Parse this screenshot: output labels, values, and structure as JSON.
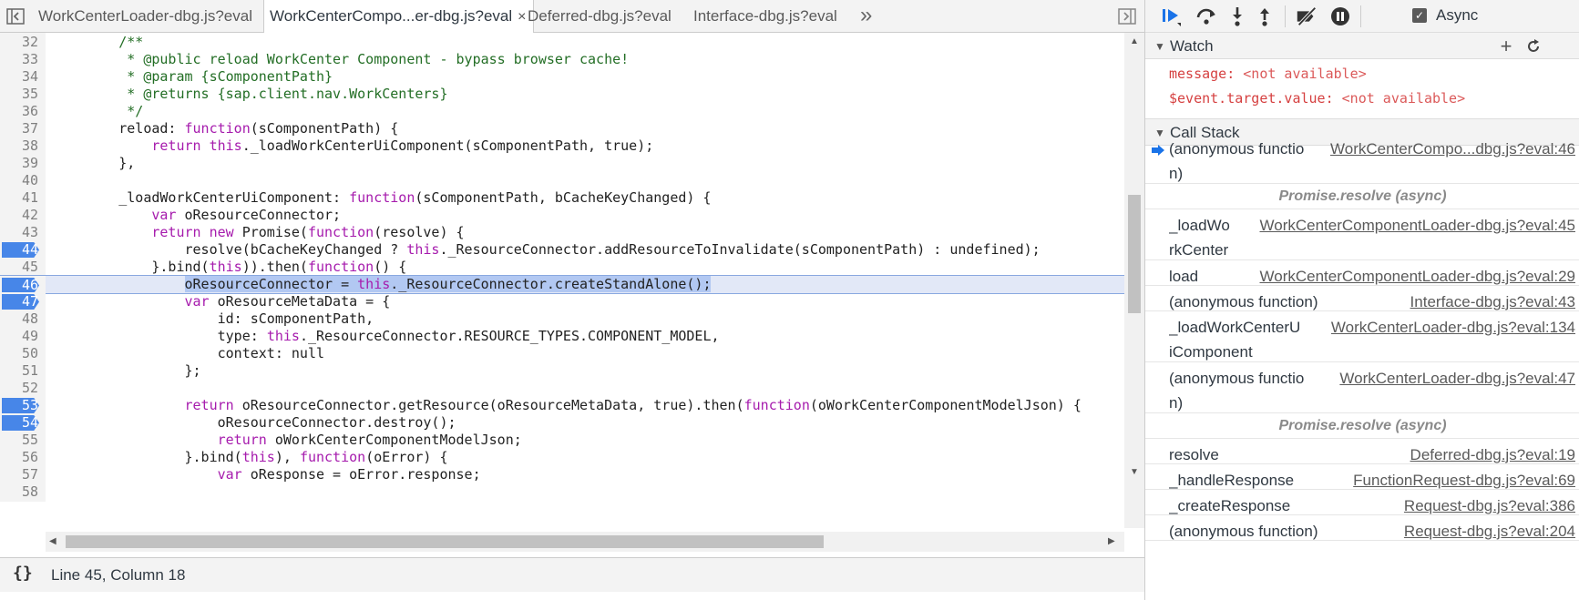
{
  "tabs": [
    {
      "label": "WorkCenterLoader-dbg.js?eval",
      "active": false
    },
    {
      "label": "WorkCenterCompo...er-dbg.js?eval",
      "active": true
    },
    {
      "label": "Deferred-dbg.js?eval",
      "active": false
    },
    {
      "label": "Interface-dbg.js?eval",
      "active": false
    }
  ],
  "tab_close_glyph": "×",
  "tab_more_glyph": "»",
  "code_lines": [
    {
      "num": "32",
      "parts": [
        {
          "t": "        "
        },
        {
          "t": "/**",
          "c": "c"
        }
      ]
    },
    {
      "num": "33",
      "parts": [
        {
          "t": "         "
        },
        {
          "t": "* @public reload WorkCenter Component - bypass browser cache!",
          "c": "c"
        }
      ]
    },
    {
      "num": "34",
      "parts": [
        {
          "t": "         "
        },
        {
          "t": "* @param {sComponentPath}",
          "c": "c"
        }
      ]
    },
    {
      "num": "35",
      "parts": [
        {
          "t": "         "
        },
        {
          "t": "* @returns {sap.client.nav.WorkCenters}",
          "c": "c"
        }
      ]
    },
    {
      "num": "36",
      "parts": [
        {
          "t": "         "
        },
        {
          "t": "*/",
          "c": "c"
        }
      ]
    },
    {
      "num": "37",
      "parts": [
        {
          "t": "        reload: "
        },
        {
          "t": "function",
          "c": "k"
        },
        {
          "t": "(sComponentPath) {"
        }
      ]
    },
    {
      "num": "38",
      "parts": [
        {
          "t": "            "
        },
        {
          "t": "return",
          "c": "k"
        },
        {
          "t": " "
        },
        {
          "t": "this",
          "c": "k"
        },
        {
          "t": "._loadWorkCenterUiComponent(sComponentPath, true);"
        }
      ]
    },
    {
      "num": "39",
      "parts": [
        {
          "t": "        },"
        }
      ]
    },
    {
      "num": "40",
      "parts": [
        {
          "t": ""
        }
      ]
    },
    {
      "num": "41",
      "parts": [
        {
          "t": "        _loadWorkCenterUiComponent: "
        },
        {
          "t": "function",
          "c": "k"
        },
        {
          "t": "(sComponentPath, bCacheKeyChanged) {"
        }
      ]
    },
    {
      "num": "42",
      "parts": [
        {
          "t": "            "
        },
        {
          "t": "var",
          "c": "k"
        },
        {
          "t": " oResourceConnector;"
        }
      ]
    },
    {
      "num": "43",
      "parts": [
        {
          "t": "            "
        },
        {
          "t": "return",
          "c": "k"
        },
        {
          "t": " "
        },
        {
          "t": "new",
          "c": "k"
        },
        {
          "t": " Promise("
        },
        {
          "t": "function",
          "c": "k"
        },
        {
          "t": "(resolve) {"
        }
      ]
    },
    {
      "num": "44",
      "bp": true,
      "parts": [
        {
          "t": "                resolve(bCacheKeyChanged ? "
        },
        {
          "t": "this",
          "c": "k"
        },
        {
          "t": "._ResourceConnector.addResourceToInvalidate(sComponentPath) : undefined);"
        }
      ]
    },
    {
      "num": "45",
      "parts": [
        {
          "t": "            }.bind("
        },
        {
          "t": "this",
          "c": "k"
        },
        {
          "t": ")).then("
        },
        {
          "t": "function",
          "c": "k"
        },
        {
          "t": "() {"
        }
      ]
    },
    {
      "num": "46",
      "bp": true,
      "exec": true,
      "parts": [
        {
          "t": "                "
        },
        {
          "t": "oResourceConnector = ",
          "c": "sel"
        },
        {
          "t": "this",
          "c": "k sel"
        },
        {
          "t": "._ResourceConnector.createStandAlone();",
          "c": "sel"
        }
      ]
    },
    {
      "num": "47",
      "bp": true,
      "parts": [
        {
          "t": "                "
        },
        {
          "t": "var",
          "c": "k"
        },
        {
          "t": " oResourceMetaData = {"
        }
      ]
    },
    {
      "num": "48",
      "parts": [
        {
          "t": "                    id: sComponentPath,"
        }
      ]
    },
    {
      "num": "49",
      "parts": [
        {
          "t": "                    type: "
        },
        {
          "t": "this",
          "c": "k"
        },
        {
          "t": "._ResourceConnector.RESOURCE_TYPES.COMPONENT_MODEL,"
        }
      ]
    },
    {
      "num": "50",
      "parts": [
        {
          "t": "                    context: null"
        }
      ]
    },
    {
      "num": "51",
      "parts": [
        {
          "t": "                };"
        }
      ]
    },
    {
      "num": "52",
      "parts": [
        {
          "t": ""
        }
      ]
    },
    {
      "num": "53",
      "bp": true,
      "parts": [
        {
          "t": "                "
        },
        {
          "t": "return",
          "c": "k"
        },
        {
          "t": " oResourceConnector.getResource(oResourceMetaData, true).then("
        },
        {
          "t": "function",
          "c": "k"
        },
        {
          "t": "(oWorkCenterComponentModelJson) {"
        }
      ]
    },
    {
      "num": "54",
      "bp": true,
      "parts": [
        {
          "t": "                    oResourceConnector.destroy();"
        }
      ]
    },
    {
      "num": "55",
      "parts": [
        {
          "t": "                    "
        },
        {
          "t": "return",
          "c": "k"
        },
        {
          "t": " oWorkCenterComponentModelJson;"
        }
      ]
    },
    {
      "num": "56",
      "parts": [
        {
          "t": "                }.bind("
        },
        {
          "t": "this",
          "c": "k"
        },
        {
          "t": "), "
        },
        {
          "t": "function",
          "c": "k"
        },
        {
          "t": "(oError) {"
        }
      ]
    },
    {
      "num": "57",
      "parts": [
        {
          "t": "                    "
        },
        {
          "t": "var",
          "c": "k"
        },
        {
          "t": " oResponse = oError.response;"
        }
      ]
    },
    {
      "num": "58",
      "parts": [
        {
          "t": ""
        }
      ]
    }
  ],
  "status": {
    "pretty_print_glyph": "{}",
    "cursor_position": "Line 45, Column 18"
  },
  "debugger": {
    "async_label": "Async",
    "async_checked": true,
    "watch": {
      "title": "Watch",
      "expressions": [
        {
          "name": "message",
          "value": "<not available>"
        },
        {
          "name": "$event.target.value",
          "value": "<not available>"
        }
      ]
    },
    "call_stack": {
      "title": "Call Stack",
      "frames": [
        {
          "kind": "frame",
          "current": true,
          "fn": "(anonymous function)",
          "loc": "WorkCenterCompo...dbg.js?eval:46",
          "fnw": 150,
          "h": 56
        },
        {
          "kind": "async",
          "label": "Promise.resolve (async)"
        },
        {
          "kind": "frame",
          "fn": "_loadWorkCenterUiComponent",
          "loc": "WorkCenterComponentLoader-dbg.js?eval:45",
          "fnw": 70,
          "h": 56
        },
        {
          "kind": "frame",
          "fn": "load",
          "loc": "WorkCenterComponentLoader-dbg.js?eval:29",
          "fnw": 70,
          "h": 28
        },
        {
          "kind": "frame",
          "fn": "(anonymous function)",
          "loc": "Interface-dbg.js?eval:43",
          "fnw": 220,
          "h": 28
        },
        {
          "kind": "frame",
          "fn": "_loadWorkCenterUiComponent",
          "loc": "WorkCenterLoader-dbg.js?eval:134",
          "fnw": 148,
          "h": 56
        },
        {
          "kind": "frame",
          "fn": "(anonymous function)",
          "loc": "WorkCenterLoader-dbg.js?eval:47",
          "fnw": 150,
          "h": 56
        },
        {
          "kind": "async",
          "label": "Promise.resolve (async)"
        },
        {
          "kind": "frame",
          "fn": "resolve",
          "loc": "Deferred-dbg.js?eval:19",
          "fnw": 200,
          "h": 28
        },
        {
          "kind": "frame",
          "fn": "_handleResponse",
          "loc": "FunctionRequest-dbg.js?eval:69",
          "fnw": 200,
          "h": 28
        },
        {
          "kind": "frame",
          "fn": "_createResponse",
          "loc": "Request-dbg.js?eval:386",
          "fnw": 200,
          "h": 28
        },
        {
          "kind": "frame",
          "fn": "(anonymous function)",
          "loc": "Request-dbg.js?eval:204",
          "fnw": 200,
          "h": 28
        }
      ]
    }
  },
  "colors": {
    "breakpoint": "#4786e8",
    "selection": "#b2c8f2",
    "exec_line": "#e2e8f7",
    "comment": "#236e25",
    "keyword": "#a61bad",
    "watch_value": "#c80000"
  }
}
